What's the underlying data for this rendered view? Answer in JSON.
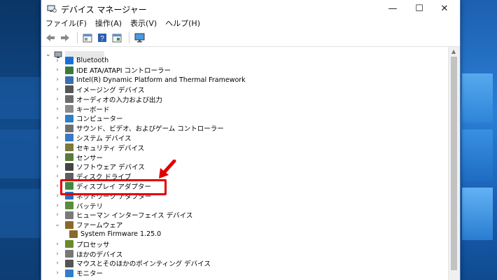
{
  "window": {
    "title": "デバイス マネージャー",
    "controls": {
      "minimize": "—",
      "maximize": "☐",
      "close": "✕"
    }
  },
  "menu": [
    "ファイル(F)",
    "操作(A)",
    "表示(V)",
    "ヘルプ(H)"
  ],
  "toolbar": {
    "icons": [
      "back-arrow-icon",
      "forward-arrow-icon",
      "properties-icon",
      "help-icon",
      "details-icon",
      "monitor-icon"
    ]
  },
  "tree": {
    "items": [
      {
        "label": "Bluetooth",
        "icon": "bluetooth-icon",
        "color": "#1a6fd6",
        "expanded": false
      },
      {
        "label": "IDE ATA/ATAPI コントローラー",
        "icon": "ide-controller-icon",
        "color": "#3c7a3c",
        "expanded": false
      },
      {
        "label": "Intel(R) Dynamic Platform and Thermal Framework",
        "icon": "framework-icon",
        "color": "#3a6fb0",
        "expanded": false
      },
      {
        "label": "イメージング デバイス",
        "icon": "camera-icon",
        "color": "#555555",
        "expanded": false
      },
      {
        "label": "オーディオの入力および出力",
        "icon": "speaker-icon",
        "color": "#6b6b6b",
        "expanded": false
      },
      {
        "label": "キーボード",
        "icon": "keyboard-icon",
        "color": "#8a8a8a",
        "expanded": false
      },
      {
        "label": "コンピューター",
        "icon": "computer-icon",
        "color": "#2f7fc8",
        "expanded": false
      },
      {
        "label": "サウンド、ビデオ、およびゲーム コントローラー",
        "icon": "sound-video-icon",
        "color": "#6f6f6f",
        "expanded": false
      },
      {
        "label": "システム デバイス",
        "icon": "system-device-icon",
        "color": "#3b78c4",
        "expanded": false
      },
      {
        "label": "セキュリティ デバイス",
        "icon": "security-device-icon",
        "color": "#7a7a3a",
        "expanded": false
      },
      {
        "label": "センサー",
        "icon": "sensor-icon",
        "color": "#5a7a3a",
        "expanded": false
      },
      {
        "label": "ソフトウェア デバイス",
        "icon": "software-device-icon",
        "color": "#444444",
        "expanded": false
      },
      {
        "label": "ディスク ドライブ",
        "icon": "disk-drive-icon",
        "color": "#5f5f5f",
        "expanded": false
      },
      {
        "label": "ディスプレイ アダプター",
        "icon": "display-adapter-icon",
        "color": "#3f8a3f",
        "expanded": false
      },
      {
        "label": "ネットワーク アダプター",
        "icon": "network-adapter-icon",
        "color": "#2f6fb8",
        "expanded": false
      },
      {
        "label": "バッテリ",
        "icon": "battery-icon",
        "color": "#5a8a3a",
        "expanded": false
      },
      {
        "label": "ヒューマン インターフェイス デバイス",
        "icon": "hid-icon",
        "color": "#7a7a7a",
        "expanded": false
      },
      {
        "label": "ファームウェア",
        "icon": "firmware-icon",
        "color": "#8a6a2a",
        "expanded": true
      },
      {
        "label": "System Firmware 1.25.0",
        "icon": "firmware-chip-icon",
        "color": "#8a6a2a",
        "child": true
      },
      {
        "label": "プロセッサ",
        "icon": "processor-icon",
        "color": "#6a8a2a",
        "expanded": false
      },
      {
        "label": "ほかのデバイス",
        "icon": "other-device-icon",
        "color": "#777777",
        "expanded": false
      },
      {
        "label": "マウスとそのほかのポインティング デバイス",
        "icon": "mouse-icon",
        "color": "#555555",
        "expanded": false
      },
      {
        "label": "モニター",
        "icon": "monitor-icon",
        "color": "#2f7fc8",
        "expanded": false
      }
    ]
  },
  "annotation": {
    "color": "#e10000"
  }
}
